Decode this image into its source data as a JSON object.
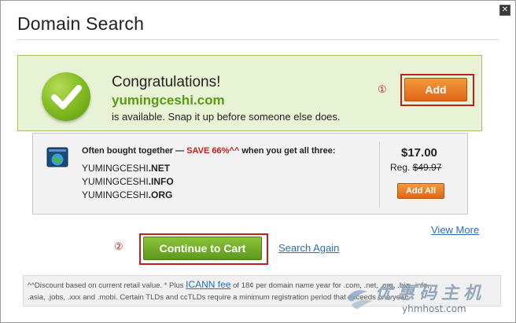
{
  "dialog": {
    "title": "Domain Search",
    "close_glyph": "✕"
  },
  "success": {
    "heading": "Congratulations!",
    "domain": "yumingceshi.com",
    "message": "is available. Snap it up before someone else does.",
    "add_label": "Add",
    "icon": "checkmark-icon"
  },
  "markers": {
    "step1": "①",
    "step2": "②"
  },
  "bundle": {
    "heading_prefix": "Often bought together — ",
    "heading_save": "SAVE 66%^^",
    "heading_suffix": " when you get all three:",
    "items": [
      {
        "name": "YUMINGCESHI",
        "tld": ".NET"
      },
      {
        "name": "YUMINGCESHI",
        "tld": ".INFO"
      },
      {
        "name": "YUMINGCESHI",
        "tld": ".ORG"
      }
    ],
    "price": "$17.00",
    "reg_label": "Reg. ",
    "reg_price": "$49.97",
    "add_all_label": "Add All",
    "icon": "browser-globe-icon"
  },
  "actions": {
    "view_more": "View More",
    "continue_to_cart": "Continue to Cart",
    "search_again": "Search Again"
  },
  "footnote": {
    "prefix": "^^Discount based on current retail value. * Plus ",
    "link": "ICANN fee",
    "line1_rest": " of 18¢ per domain name year for .com, .net, .org, .biz, .info,",
    "line2": ".asia, .jobs, .xxx and .mobi. Certain TLDs and ccTLDs require a minimum registration period that exceeds one year."
  },
  "watermark": {
    "main": "优惠码主机",
    "sub": "yhmhost.com"
  },
  "colors": {
    "accent_green": "#5a9a14",
    "success_bg": "#e8f2d4",
    "orange_button": "#e0661a",
    "annotation_red": "#c0201a",
    "link_blue": "#2a6ebb"
  }
}
